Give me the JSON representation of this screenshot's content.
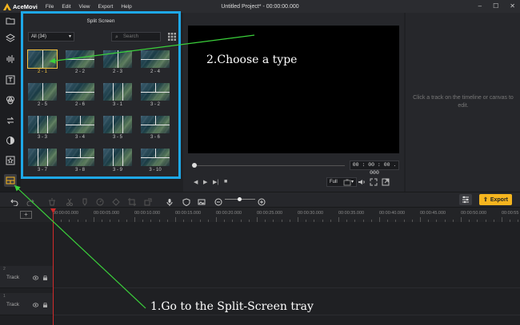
{
  "app": {
    "logo": "AceMovi",
    "menu": [
      "File",
      "Edit",
      "View",
      "Export",
      "Help"
    ],
    "window_title": "Untitled Project* - 00:00:00.000",
    "window_controls": [
      "minimize-icon",
      "maximize-icon",
      "close-icon"
    ]
  },
  "sidebar": {
    "icons": [
      "folder-icon",
      "layers-icon",
      "audio-icon",
      "text-icon",
      "effects-icon",
      "transition-icon",
      "filter-icon",
      "sticker-icon",
      "split-screen-icon"
    ],
    "active": "split-screen-icon"
  },
  "split_panel": {
    "title": "Split Screen",
    "category": "All (34)",
    "search_placeholder": "Search",
    "layouts": [
      {
        "label": "2 - 1",
        "selected": true
      },
      {
        "label": "2 - 2"
      },
      {
        "label": "2 - 3"
      },
      {
        "label": "2 - 4"
      },
      {
        "label": "2 - 5"
      },
      {
        "label": "2 - 6"
      },
      {
        "label": "3 - 1"
      },
      {
        "label": "3 - 2"
      },
      {
        "label": "3 - 3"
      },
      {
        "label": "3 - 4"
      },
      {
        "label": "3 - 5"
      },
      {
        "label": "3 - 6"
      },
      {
        "label": "3 - 7"
      },
      {
        "label": "3 - 8"
      },
      {
        "label": "3 - 9"
      },
      {
        "label": "3 - 10"
      }
    ]
  },
  "preview": {
    "timecode": "00 : 00 : 00 . 000",
    "fit": "Full",
    "progress": 0
  },
  "properties": {
    "hint": "Click a track on the timeline or canvas to edit."
  },
  "toolbar": {
    "export_label": "Export",
    "accent": "#f5b51f"
  },
  "timeline": {
    "ruler": [
      "00:00:00.000",
      "00:00:05.000",
      "00:00:10.000",
      "00:00:15.000",
      "00:00:20.000",
      "00:00:25.000",
      "00:00:30.000",
      "00:00:35.000",
      "00:00:40.000",
      "00:00:45.000",
      "00:00:50.000",
      "00:00:55"
    ],
    "add_label": "+",
    "tracks": [
      {
        "num": "2",
        "name": "Track"
      },
      {
        "num": "1",
        "name": "Track"
      }
    ]
  },
  "annotations": {
    "step2": "2.Choose a type",
    "step1": "1.Go to the Split-Screen tray",
    "arrow_color": "#3bd13b",
    "frame_color": "#1ea8e8"
  }
}
